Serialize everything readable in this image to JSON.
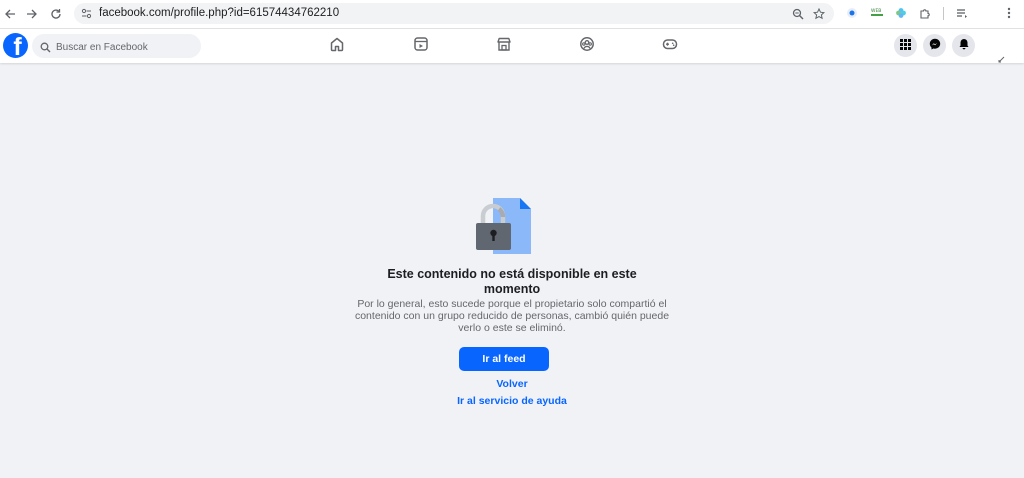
{
  "browser": {
    "url": "facebook.com/profile.php?id=61574434762210"
  },
  "header": {
    "search": {
      "placeholder": "Buscar en Facebook"
    }
  },
  "message": {
    "title": "Este contenido no está disponible en este momento",
    "body": "Por lo general, esto sucede porque el propietario solo compartió el contenido con un grupo reducido de personas, cambió quién puede verlo o este se eliminó.",
    "primary_button": "Ir al feed",
    "back_link": "Volver",
    "help_link": "Ir al servicio de ayuda"
  },
  "colors": {
    "brand": "#0866ff",
    "page_bg": "#f0f2f5",
    "lock_body": "#606770",
    "document": "#8bb8f8"
  }
}
